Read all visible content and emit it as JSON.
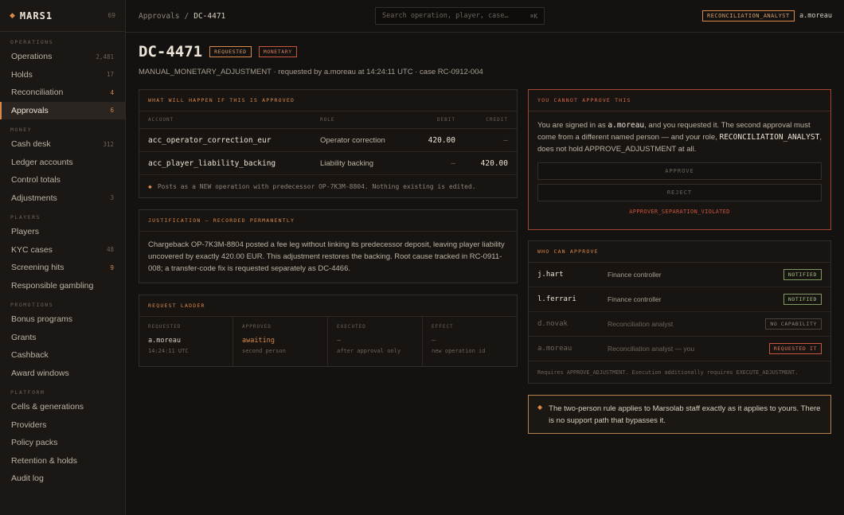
{
  "brand": {
    "name": "MARS1",
    "count": "69"
  },
  "sidebar": {
    "sections": [
      {
        "title": "OPERATIONS",
        "items": [
          {
            "label": "Operations",
            "badge": "2,481"
          },
          {
            "label": "Holds",
            "badge": "17"
          },
          {
            "label": "Reconciliation",
            "badge": "4",
            "hot": true
          },
          {
            "label": "Approvals",
            "badge": "6",
            "hot": true,
            "active": true
          }
        ]
      },
      {
        "title": "MONEY",
        "items": [
          {
            "label": "Cash desk",
            "badge": "312"
          },
          {
            "label": "Ledger accounts",
            "badge": ""
          },
          {
            "label": "Control totals",
            "badge": ""
          },
          {
            "label": "Adjustments",
            "badge": "3"
          }
        ]
      },
      {
        "title": "PLAYERS",
        "items": [
          {
            "label": "Players",
            "badge": ""
          },
          {
            "label": "KYC cases",
            "badge": "48"
          },
          {
            "label": "Screening hits",
            "badge": "9",
            "hot": true
          },
          {
            "label": "Responsible gambling",
            "badge": ""
          }
        ]
      },
      {
        "title": "PROMOTIONS",
        "items": [
          {
            "label": "Bonus programs",
            "badge": ""
          },
          {
            "label": "Grants",
            "badge": ""
          },
          {
            "label": "Cashback",
            "badge": ""
          },
          {
            "label": "Award windows",
            "badge": ""
          }
        ]
      },
      {
        "title": "PLATFORM",
        "items": [
          {
            "label": "Cells & generations",
            "badge": ""
          },
          {
            "label": "Providers",
            "badge": ""
          },
          {
            "label": "Policy packs",
            "badge": ""
          },
          {
            "label": "Retention & holds",
            "badge": ""
          },
          {
            "label": "Audit log",
            "badge": ""
          }
        ]
      }
    ]
  },
  "topbar": {
    "breadcrumb_parent": "Approvals",
    "breadcrumb_sep": "/",
    "breadcrumb_current": "DC-4471",
    "search_placeholder": "Search operation, player, case…",
    "search_kbd": "⌘K",
    "role": "RECONCILIATION_ANALYST",
    "user": "a.moreau"
  },
  "header": {
    "title": "DC-4471",
    "tag_status": "REQUESTED",
    "tag_type": "MONETARY",
    "subtitle": "MANUAL_MONETARY_ADJUSTMENT · requested by a.moreau at 14:24:11 UTC · case RC-0912-004"
  },
  "effects": {
    "heading": "WHAT WILL HAPPEN IF THIS IS APPROVED",
    "columns": {
      "account": "ACCOUNT",
      "role": "ROLE",
      "debit": "DEBIT",
      "credit": "CREDIT"
    },
    "rows": [
      {
        "account": "acc_operator_correction_eur",
        "role": "Operator correction",
        "debit": "420.00",
        "credit": "—"
      },
      {
        "account": "acc_player_liability_backing",
        "role": "Liability backing",
        "debit": "—",
        "credit": "420.00"
      }
    ],
    "note": "Posts as a NEW operation with predecessor OP-7K3M-8804. Nothing existing is edited."
  },
  "justification": {
    "heading": "JUSTIFICATION — RECORDED PERMANENTLY",
    "text": "Chargeback OP-7K3M-8804 posted a fee leg without linking its predecessor deposit, leaving player liability uncovered by exactly 420.00 EUR. This adjustment restores the backing. Root cause tracked in RC-0911-008; a transfer-code fix is requested separately as DC-4466."
  },
  "ladder": {
    "heading": "REQUEST LADDER",
    "steps": [
      {
        "label": "REQUESTED",
        "value": "a.moreau",
        "sub": "14:24:11 UTC"
      },
      {
        "label": "APPROVED",
        "value": "awaiting",
        "sub": "second person"
      },
      {
        "label": "EXECUTED",
        "value": "—",
        "sub": "after approval only"
      },
      {
        "label": "EFFECT",
        "value": "—",
        "sub": "new operation id"
      }
    ]
  },
  "cannot": {
    "heading": "YOU CANNOT APPROVE THIS",
    "text_1": "You are signed in as ",
    "user": "a.moreau",
    "text_2": ", and you requested it. The second approval must come from a different named person — and your role, ",
    "role": "RECONCILIATION_ANALYST",
    "text_3": ", does not hold APPROVE_ADJUSTMENT at all.",
    "approve_label": "APPROVE",
    "reject_label": "REJECT",
    "violation": "APPROVER_SEPARATION_VIOLATED"
  },
  "approvers": {
    "heading": "WHO CAN APPROVE",
    "rows": [
      {
        "user": "j.hart",
        "role": "Finance controller",
        "badge": "NOTIFIED"
      },
      {
        "user": "l.ferrari",
        "role": "Finance controller",
        "badge": "NOTIFIED"
      },
      {
        "user": "d.novak",
        "role": "Reconciliation analyst",
        "badge": "NO CAPABILITY"
      },
      {
        "user": "a.moreau",
        "role": "Reconciliation analyst — you",
        "badge": "REQUESTED IT"
      }
    ],
    "note": "Requires APPROVE_ADJUSTMENT. Execution additionally requires EXECUTE_ADJUSTMENT."
  },
  "rule": {
    "text": "The two-person rule applies to Marsolab staff exactly as it applies to yours. There is no support path that bypasses it."
  },
  "colors": {
    "accent": "#d9894a",
    "danger": "#c8553d",
    "ok": "#a9c383",
    "background": "#141210"
  },
  "icons": {
    "brand": "diamond-icon",
    "note": "diamond-icon"
  }
}
